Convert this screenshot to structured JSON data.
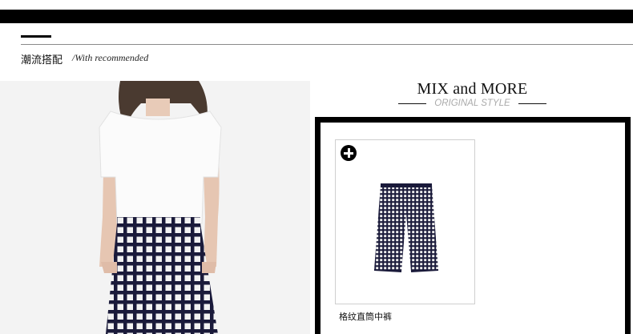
{
  "section": {
    "title": "潮流搭配",
    "subtitle": "/With recommended"
  },
  "mix": {
    "title": "MIX and MORE",
    "subtitle": "ORIGINAL STYLE"
  },
  "products": [
    {
      "name": "格纹直筒中裤",
      "icon": "plus-circle-icon"
    }
  ],
  "colors": {
    "bar": "#000000",
    "frame": "#000000",
    "subtitle_gray": "#aaaaaa",
    "check_navy": "#1a1a3a"
  }
}
